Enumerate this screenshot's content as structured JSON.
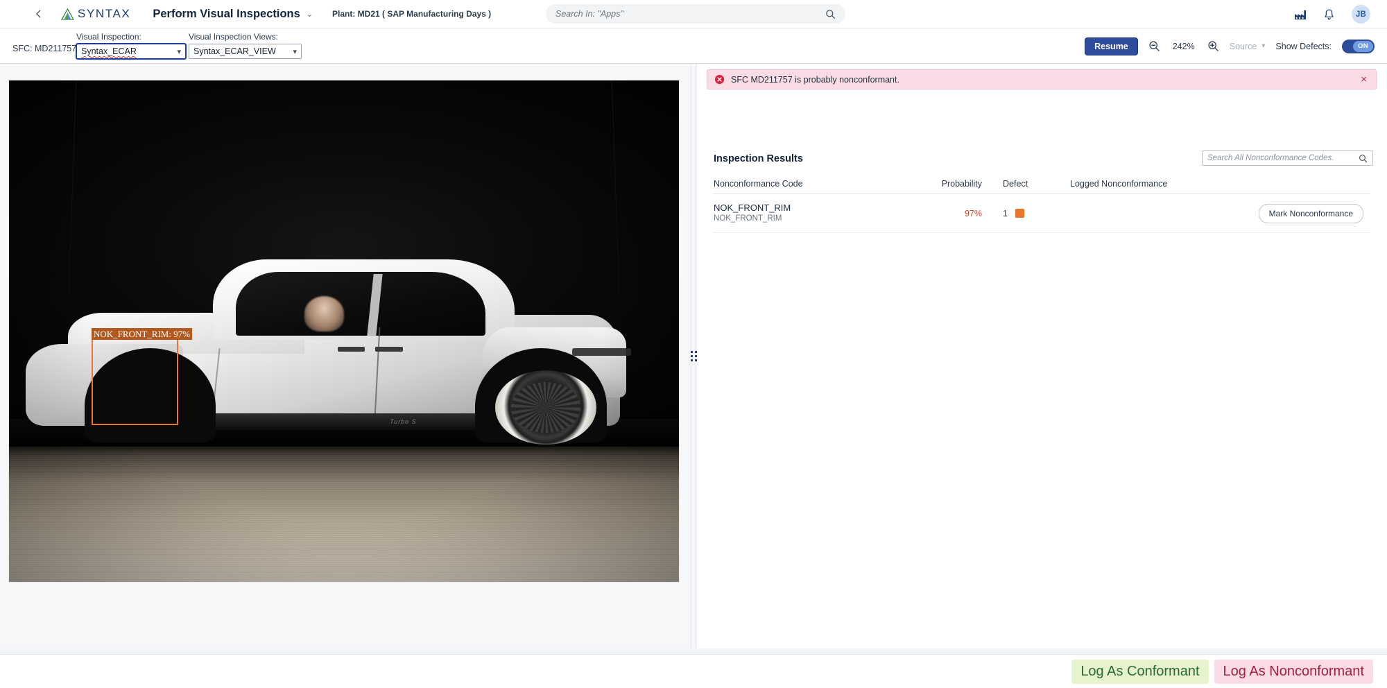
{
  "header": {
    "back_icon": "chevron-left-icon",
    "brand": "SYNTAX",
    "app_title": "Perform Visual Inspections",
    "app_title_caret": "⌄",
    "plant_context": "Plant: MD21 ( SAP Manufacturing Days )",
    "search_placeholder": "Search In: \"Apps\"",
    "search_value": "",
    "search_icon": "search-icon",
    "plant_icon": "factory-icon",
    "notifications_icon": "bell-icon",
    "avatar_initials": "JB"
  },
  "toolbar": {
    "sfc_label": "SFC: MD211757",
    "visual_inspection_label": "Visual Inspection:",
    "visual_inspection_value": "Syntax_ECAR",
    "visual_inspection_views_label": "Visual Inspection Views:",
    "visual_inspection_views_value": "Syntax_ECAR_VIEW",
    "resume_label": "Resume",
    "zoom_out_icon": "zoom-out-icon",
    "zoom_level": "242%",
    "zoom_in_icon": "zoom-in-icon",
    "source_label": "Source",
    "source_caret": "⌄",
    "show_defects_label": "Show Defects:",
    "show_defects_state": "ON"
  },
  "viewer": {
    "annotation_label": "NOK_FRONT_RIM: 97%",
    "splitter_icon": "drag-handle-icon"
  },
  "alert": {
    "icon": "error-circle-icon",
    "message": "SFC MD211757 is probably nonconformant.",
    "close_label": "×"
  },
  "results": {
    "title": "Inspection Results",
    "search_placeholder": "Search All Nonconformance Codes.",
    "search_value": "",
    "search_icon": "search-icon",
    "columns": {
      "code": "Nonconformance Code",
      "probability": "Probability",
      "defect": "Defect",
      "logged": "Logged Nonconformance",
      "action": ""
    },
    "rows": [
      {
        "code": "NOK_FRONT_RIM",
        "code_sub": "NOK_FRONT_RIM",
        "probability": "97%",
        "defect_count": "1",
        "defect_color": "#e8762b",
        "logged": "",
        "action_label": "Mark Nonconformance"
      }
    ]
  },
  "footer": {
    "conformant_label": "Log As Conformant",
    "nonconformant_label": "Log As Nonconformant"
  },
  "colors": {
    "brand_blue": "#1f3a6e",
    "accent_blue": "#2e4c9c",
    "defect_orange": "#e8762b",
    "error_pink": "#fbdce4",
    "error_red": "#c0213c",
    "success_green": "#2c6b2f"
  }
}
